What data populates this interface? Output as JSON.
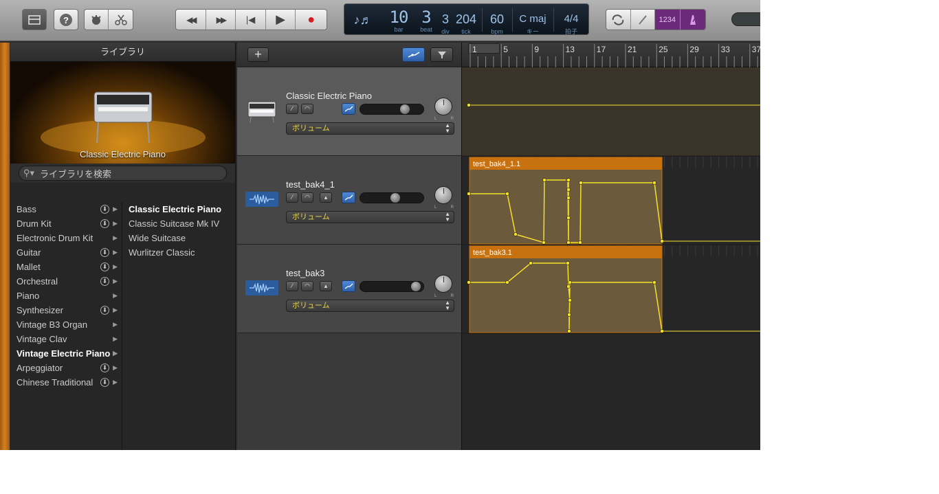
{
  "toolbar": {
    "buttons": [
      "library-icon",
      "help-icon",
      "smart-controls-icon",
      "editors-icon"
    ],
    "transport": [
      "rewind",
      "fast-forward",
      "go-to-start",
      "play",
      "record"
    ],
    "play_symbol": "▶",
    "record_symbol": "●",
    "rewind_symbol": "◀◀",
    "ff_symbol": "▶▶",
    "start_symbol": "|◀"
  },
  "lcd": {
    "bar": "10",
    "bar_label": "bar",
    "beat": "3",
    "beat_label": "beat",
    "div": "3",
    "div_label": "div",
    "tick": "204",
    "tick_label": "tick",
    "bpm": "60",
    "bpm_label": "bpm",
    "key": "C maj",
    "key_label": "キー",
    "sig": "4/4",
    "sig_label": "拍子",
    "count_in": "1234"
  },
  "library": {
    "title": "ライブラリ",
    "hero_name": "Classic Electric Piano",
    "search_placeholder": "ライブラリを検索",
    "categories": [
      {
        "label": "Bass",
        "download": true
      },
      {
        "label": "Drum Kit",
        "download": true
      },
      {
        "label": "Electronic Drum Kit",
        "download": false
      },
      {
        "label": "Guitar",
        "download": true
      },
      {
        "label": "Mallet",
        "download": true
      },
      {
        "label": "Orchestral",
        "download": true
      },
      {
        "label": "Piano",
        "download": false
      },
      {
        "label": "Synthesizer",
        "download": true
      },
      {
        "label": "Vintage B3 Organ",
        "download": false
      },
      {
        "label": "Vintage Clav",
        "download": false
      },
      {
        "label": "Vintage Electric Piano",
        "download": false,
        "selected": true
      },
      {
        "label": "Arpeggiator",
        "download": true
      },
      {
        "label": "Chinese Traditional",
        "download": true
      }
    ],
    "presets": [
      {
        "label": "Classic Electric Piano",
        "selected": true
      },
      {
        "label": "Classic Suitcase Mk IV"
      },
      {
        "label": "Wide Suitcase"
      },
      {
        "label": "Wurlitzer Classic"
      }
    ]
  },
  "tracks": [
    {
      "name": "Classic Electric Piano",
      "type": "instrument",
      "automation": "ボリューム",
      "volume_fraction": 0.74,
      "selected": true
    },
    {
      "name": "test_bak4_1",
      "type": "audio",
      "automation": "ボリューム",
      "volume_fraction": 0.57
    },
    {
      "name": "test_bak3",
      "type": "audio",
      "automation": "ボリューム",
      "volume_fraction": 0.95
    }
  ],
  "ruler": [
    "1",
    "5",
    "9",
    "13",
    "17",
    "21",
    "25",
    "29",
    "33",
    "37"
  ],
  "regions": [
    {
      "name": "test_bak4_1.1",
      "track": 1
    },
    {
      "name": "test_bak3.1",
      "track": 2
    }
  ],
  "colors": {
    "region_header": "#c8720f",
    "automation": "#f5e12a",
    "accent": "#4f8ad6",
    "count_in": "#7a2a8a"
  }
}
